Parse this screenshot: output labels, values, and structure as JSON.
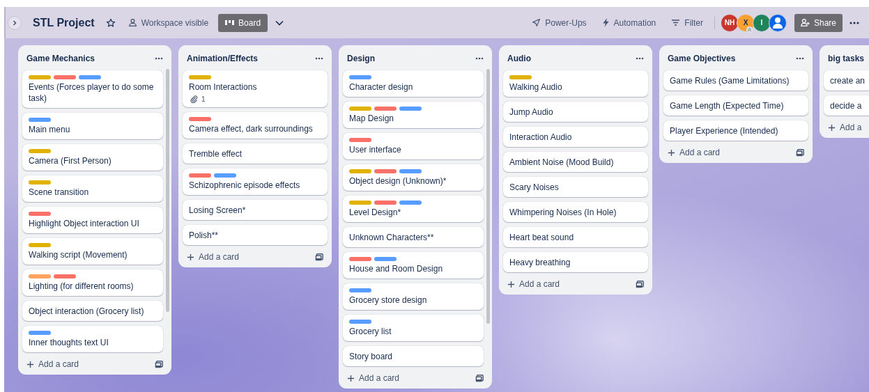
{
  "board": {
    "title": "STL Project",
    "starred": false,
    "visibility": "Workspace visible",
    "view": "Board"
  },
  "toolbar": [
    {
      "label": "Power-Ups",
      "kind": "power-ups"
    },
    {
      "label": "Automation",
      "kind": "automation"
    },
    {
      "label": "Filter",
      "kind": "filter"
    }
  ],
  "members": [
    {
      "kind": "initials",
      "initials": "NH",
      "color": "#c9372c"
    },
    {
      "kind": "initials",
      "initials": "X",
      "color": "#f8a130",
      "admin": true
    },
    {
      "kind": "initials",
      "initials": "I",
      "color": "#1f845a"
    },
    {
      "kind": "silhouette",
      "color": "#0c66e4"
    }
  ],
  "share": "Share",
  "lists": [
    {
      "title": "Game Mechanics",
      "add_label": "Add a card",
      "cards": [
        {
          "title": "Events (Forces player to do some task)",
          "labels": [
            {
              "color": "#e2b203"
            },
            {
              "color": "#f87168"
            },
            {
              "color": "#579dff"
            }
          ]
        },
        {
          "title": "Main menu",
          "labels": [
            {
              "color": "#579dff"
            }
          ]
        },
        {
          "title": "Camera (First Person)",
          "labels": [
            {
              "color": "#e2b203"
            }
          ]
        },
        {
          "title": "Scene transition",
          "labels": [
            {
              "color": "#e2b203"
            }
          ]
        },
        {
          "title": "Highlight Object interaction UI",
          "labels": [
            {
              "color": "#f87168"
            }
          ]
        },
        {
          "title": "Walking script (Movement)",
          "labels": [
            {
              "color": "#e2b203"
            }
          ]
        },
        {
          "title": "Lighting (for different rooms)",
          "labels": [
            {
              "color": "#fea362"
            },
            {
              "color": "#f87168"
            }
          ]
        },
        {
          "title": "Object interaction (Grocery list)"
        },
        {
          "title": "Inner thoughts text UI",
          "labels": [
            {
              "color": "#579dff"
            }
          ]
        }
      ]
    },
    {
      "title": "Animation/Effects",
      "add_label": "Add a card",
      "cards": [
        {
          "title": "Room Interactions",
          "labels": [
            {
              "color": "#e2b203"
            }
          ],
          "attachments": "1"
        },
        {
          "title": "Camera effect, dark surroundings",
          "labels": [
            {
              "color": "#f87168"
            }
          ]
        },
        {
          "title": "Tremble effect"
        },
        {
          "title": "Schizophrenic episode effects",
          "labels": [
            {
              "color": "#f87168"
            },
            {
              "color": "#579dff"
            }
          ]
        },
        {
          "title": "Losing Screen*"
        },
        {
          "title": "Polish**"
        }
      ]
    },
    {
      "title": "Design",
      "add_label": "Add a card",
      "cards": [
        {
          "title": "Character design",
          "labels": [
            {
              "color": "#579dff"
            }
          ]
        },
        {
          "title": "Map Design",
          "labels": [
            {
              "color": "#e2b203"
            },
            {
              "color": "#f87168"
            },
            {
              "color": "#579dff"
            }
          ]
        },
        {
          "title": "User interface",
          "labels": [
            {
              "color": "#f87168"
            }
          ]
        },
        {
          "title": "Object design (Unknown)*",
          "labels": [
            {
              "color": "#e2b203"
            },
            {
              "color": "#f87168"
            },
            {
              "color": "#579dff"
            }
          ]
        },
        {
          "title": "Level Design*",
          "labels": [
            {
              "color": "#e2b203"
            },
            {
              "color": "#f87168"
            },
            {
              "color": "#579dff"
            }
          ]
        },
        {
          "title": "Unknown Characters**"
        },
        {
          "title": "House and Room Design",
          "labels": [
            {
              "color": "#f87168"
            },
            {
              "color": "#579dff"
            }
          ]
        },
        {
          "title": "Grocery store design",
          "labels": [
            {
              "color": "#579dff"
            }
          ]
        },
        {
          "title": "Grocery list",
          "labels": [
            {
              "color": "#579dff"
            }
          ]
        },
        {
          "title": "Story board"
        }
      ]
    },
    {
      "title": "Audio",
      "add_label": "Add a card",
      "cards": [
        {
          "title": "Walking Audio",
          "labels": [
            {
              "color": "#e2b203"
            }
          ]
        },
        {
          "title": "Jump Audio"
        },
        {
          "title": "Interaction Audio"
        },
        {
          "title": "Ambient Noise (Mood Build)"
        },
        {
          "title": "Scary Noises"
        },
        {
          "title": "Whimpering Noises (In Hole)"
        },
        {
          "title": "Heart beat sound"
        },
        {
          "title": "Heavy breathing"
        }
      ]
    },
    {
      "title": "Game Objectives",
      "add_label": "Add a card",
      "cards": [
        {
          "title": "Game Rules (Game Limitations)"
        },
        {
          "title": "Game Length (Expected Time)"
        },
        {
          "title": "Player Experience (Intended)"
        }
      ]
    },
    {
      "title": "big tasks",
      "add_label": "Add a",
      "cards": [
        {
          "title": "create an"
        },
        {
          "title": "decide a"
        }
      ]
    }
  ]
}
